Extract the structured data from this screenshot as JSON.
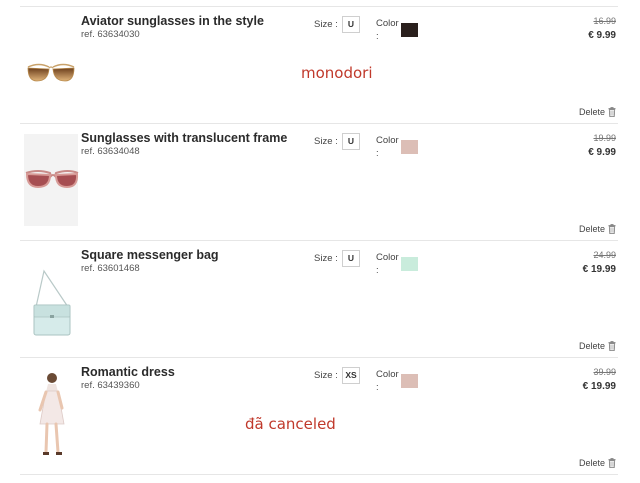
{
  "labels": {
    "size": "Size :",
    "color": "Color\n:",
    "delete": "Delete"
  },
  "items": [
    {
      "title": "Aviator sunglasses in the style",
      "ref": "ref. 63634030",
      "size": "U",
      "color_hex": "#2a201d",
      "old_price": "16.99",
      "price": "€ 9.99",
      "image_icon": "aviator-sunglasses"
    },
    {
      "title": "Sunglasses with translucent frame",
      "ref": "ref. 63634048",
      "size": "U",
      "color_hex": "#dcbeb6",
      "old_price": "19.99",
      "price": "€ 9.99",
      "image_icon": "translucent-sunglasses"
    },
    {
      "title": "Square messenger bag",
      "ref": "ref. 63601468",
      "size": "U",
      "color_hex": "#c9ecdc",
      "old_price": "24.99",
      "price": "€ 19.99",
      "image_icon": "messenger-bag"
    },
    {
      "title": "Romantic dress",
      "ref": "ref. 63439360",
      "size": "XS",
      "color_hex": "#dcbeb6",
      "old_price": "39.99",
      "price": "€ 19.99",
      "image_icon": "dress"
    }
  ],
  "annotations": {
    "first": "monodori",
    "second": "đã canceled",
    "color_hex": "#c0392b"
  }
}
